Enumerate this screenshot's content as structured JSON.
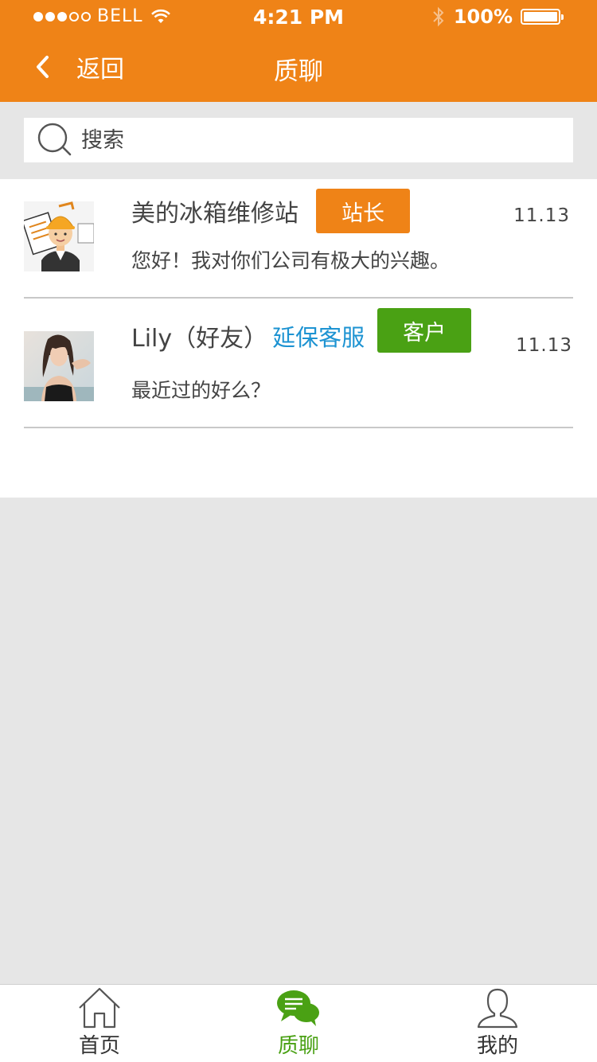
{
  "status_bar": {
    "carrier": "BELL",
    "time": "4:21 PM",
    "battery": "100%"
  },
  "nav": {
    "back_label": "返回",
    "title": "质聊"
  },
  "search": {
    "placeholder": "搜索"
  },
  "chats": [
    {
      "name": "美的冰箱维修站",
      "role": "",
      "tag": "站长",
      "tag_color": "#ef8317",
      "date": "11.13",
      "message": "您好！我对你们公司有极大的兴趣。",
      "avatar": "worker-avatar"
    },
    {
      "name": "Lily（好友）",
      "role": "延保客服",
      "tag": "客户",
      "tag_color": "#4aa114",
      "date": "11.13",
      "message": "最近过的好么？",
      "avatar": "woman-photo-avatar"
    }
  ],
  "tabbar": {
    "items": [
      {
        "label": "首页",
        "icon": "home-icon",
        "active": false
      },
      {
        "label": "质聊",
        "icon": "chat-icon",
        "active": true
      },
      {
        "label": "我的",
        "icon": "user-icon",
        "active": false
      }
    ]
  },
  "colors": {
    "brand_orange": "#ef8317",
    "active_green": "#4aa114",
    "link_blue": "#1d93d2"
  }
}
